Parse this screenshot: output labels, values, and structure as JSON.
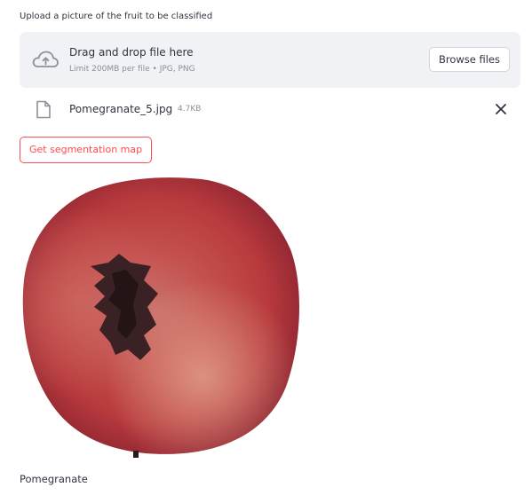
{
  "uploader": {
    "label": "Upload a picture of the fruit to be classified",
    "drop_title": "Drag and drop file here",
    "drop_sub": "Limit 200MB per file • JPG, PNG",
    "browse_label": "Browse files"
  },
  "file": {
    "name": "Pomegranate_5.jpg",
    "size": "4.7KB"
  },
  "segmentation_button": "Get segmentation map",
  "image": {
    "subject": "pomegranate photo"
  },
  "result": "Pomegranate",
  "colors": {
    "accent": "#ff4b4b",
    "dropzone_bg": "#f0f2f6",
    "text": "#31333f",
    "muted": "#8c8f98"
  }
}
